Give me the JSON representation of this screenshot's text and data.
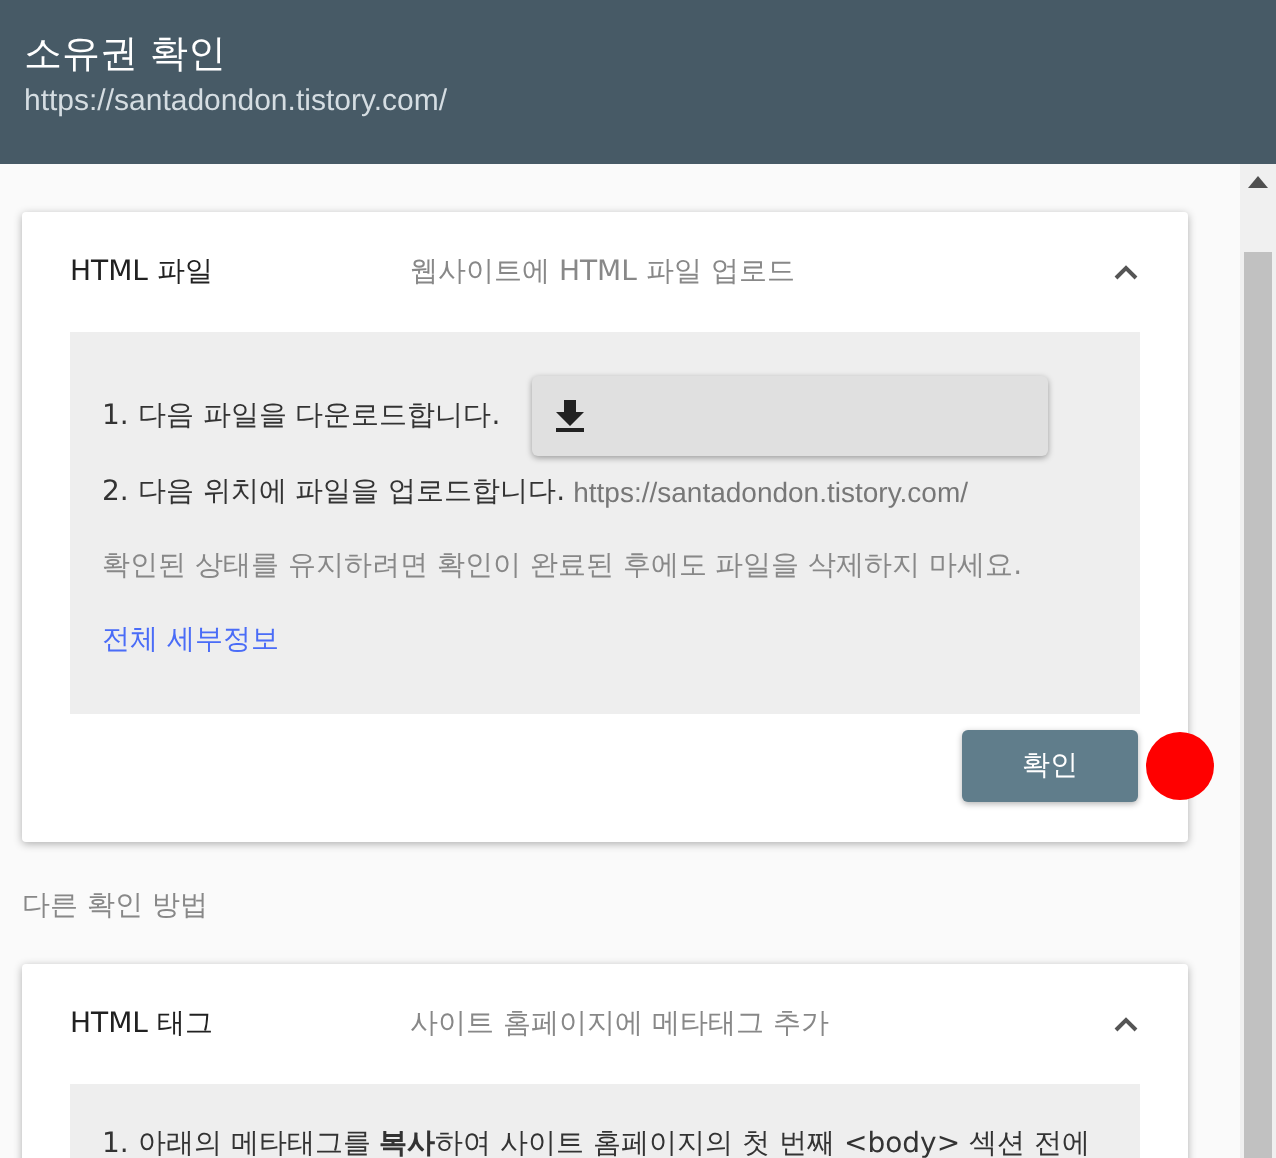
{
  "header": {
    "title": "소유권 확인",
    "url": "https://santadondon.tistory.com/"
  },
  "cards": [
    {
      "kind": "file",
      "name": "HTML 파일",
      "description": "웹사이트에 HTML 파일 업로드",
      "expanded": true,
      "step_1": "1. 다음 파일을 다운로드합니다.",
      "step_2": "2. 다음 위치에 파일을 업로드합니다.",
      "step_2_url": "https://santadondon.tistory.com/",
      "note": "확인된 상태를 유지하려면 확인이 완료된 후에도 파일을 삭제하지 마세요.",
      "details_link": "전체 세부정보",
      "verify_button": "확인"
    },
    {
      "kind": "tag",
      "section_label": "다른 확인 방법",
      "name": "HTML 태그",
      "description": "사이트 홈페이지에 메타태그 추가",
      "expanded": true,
      "step_1": "1. 아래의 메타태그를 **복사**하여 사이트 홈페이지의 첫 번째 <body> 섹션 전에"
    }
  ]
}
